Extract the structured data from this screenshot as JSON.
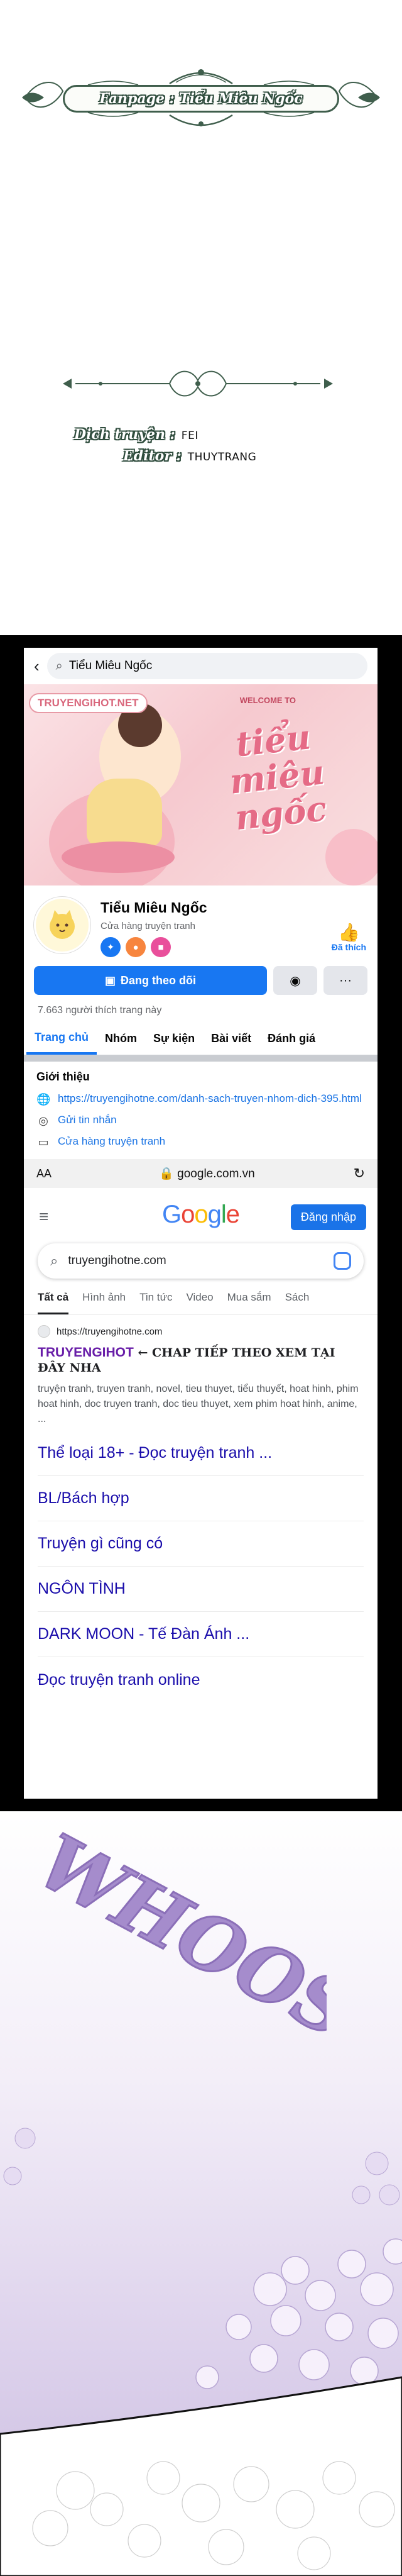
{
  "credits": {
    "fanpage": "Fanpage : Tiểu Miêu Ngốc",
    "translator_label": "Dịch truyện :",
    "translator_value": "FEI",
    "editor_label": "Editor :",
    "editor_value": "THUYTRANG"
  },
  "facebook": {
    "search_text": "Tiểu Miêu Ngốc",
    "cover": {
      "brand": "TRUYENGIHOT.NET",
      "welcome": "WELCOME TO",
      "title": "tiểu miêu ngốc"
    },
    "page_name": "Tiểu Miêu Ngốc",
    "category": "Cửa hàng truyện tranh",
    "liked_label": "Đã thích",
    "follow_button": "Đang theo dõi",
    "likes_count": "7.663 người thích trang này",
    "tabs": [
      {
        "label": "Trang chủ"
      },
      {
        "label": "Nhóm"
      },
      {
        "label": "Sự kiện"
      },
      {
        "label": "Bài viết"
      },
      {
        "label": "Đánh giá"
      }
    ],
    "intro": {
      "heading": "Giới thiệu",
      "link": "https://truyengihotne.com/danh-sach-truyen-nhom-dich-395.html",
      "message": "Gửi tin nhắn",
      "shop": "Cửa hàng truyện tranh"
    }
  },
  "browser": {
    "aa": "AA",
    "domain": "google.com.vn"
  },
  "google": {
    "logo_letters": [
      {
        "ch": "G",
        "color": "#4285f4"
      },
      {
        "ch": "o",
        "color": "#ea4335"
      },
      {
        "ch": "o",
        "color": "#fbbc05"
      },
      {
        "ch": "g",
        "color": "#4285f4"
      },
      {
        "ch": "l",
        "color": "#34a853"
      },
      {
        "ch": "e",
        "color": "#ea4335"
      }
    ],
    "signin": "Đăng nhập",
    "query": "truyengihotne.com",
    "tabs": [
      {
        "label": "Tất cả"
      },
      {
        "label": "Hình ảnh"
      },
      {
        "label": "Tin tức"
      },
      {
        "label": "Video"
      },
      {
        "label": "Mua sắm"
      },
      {
        "label": "Sách"
      }
    ],
    "result": {
      "site": "https://truyengihotne.com",
      "title_brand": "TRUYENGIHOT",
      "title_tail": " ← CHAP TIẾP THEO XEM TẠI ĐÂY NHA",
      "snippet": "truyện tranh, truyen tranh, novel, tieu thuyet, tiểu thuyết, hoat hinh, phim hoat hinh, doc truyen tranh, doc tieu thuyet, xem phim hoat hinh, anime, ..."
    },
    "sitelinks": [
      {
        "label": "Thể loại 18+ - Đọc truyện tranh ..."
      },
      {
        "label": "BL/Bách hợp"
      },
      {
        "label": "Truyện gì cũng có"
      },
      {
        "label": "NGÔN TÌNH"
      },
      {
        "label": "DARK MOON - Tế Đàn Ánh ..."
      },
      {
        "label": "Đọc truyện tranh online"
      }
    ]
  },
  "art": {
    "sfx": "WHOOSH"
  },
  "colors": {
    "facebook_blue": "#1877f2",
    "google_link": "#1a0dab",
    "brand_purple": "#681da8",
    "credit_green": "#2f4c3d",
    "sfx_purple": "#a58ccc"
  }
}
